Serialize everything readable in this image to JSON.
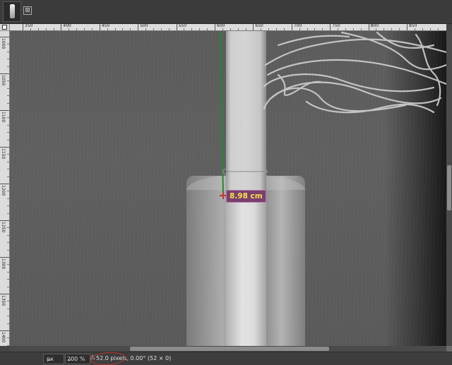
{
  "tab": {
    "close_glyph": "⊠"
  },
  "ruler": {
    "horizontal_labels": [
      "350",
      "400",
      "450",
      "500",
      "550",
      "600",
      "650",
      "700",
      "750",
      "800",
      "850"
    ],
    "vertical_labels": [
      "1000",
      "1050",
      "1100",
      "1150",
      "1200",
      "1250",
      "1300",
      "1350",
      "1400"
    ]
  },
  "measure": {
    "label": "8.98 cm",
    "line_color": "#1e8a2e",
    "marker_color": "#c0392b"
  },
  "statusbar": {
    "unit": "px",
    "zoom": "200 %",
    "warning_icon": "warning-icon",
    "message": "52.0 pixels, 0.00° (52 × 0)"
  },
  "colors": {
    "label_bg": "#7a3f6f",
    "label_text": "#f4e34a",
    "annotation_circle": "#c0392b"
  }
}
